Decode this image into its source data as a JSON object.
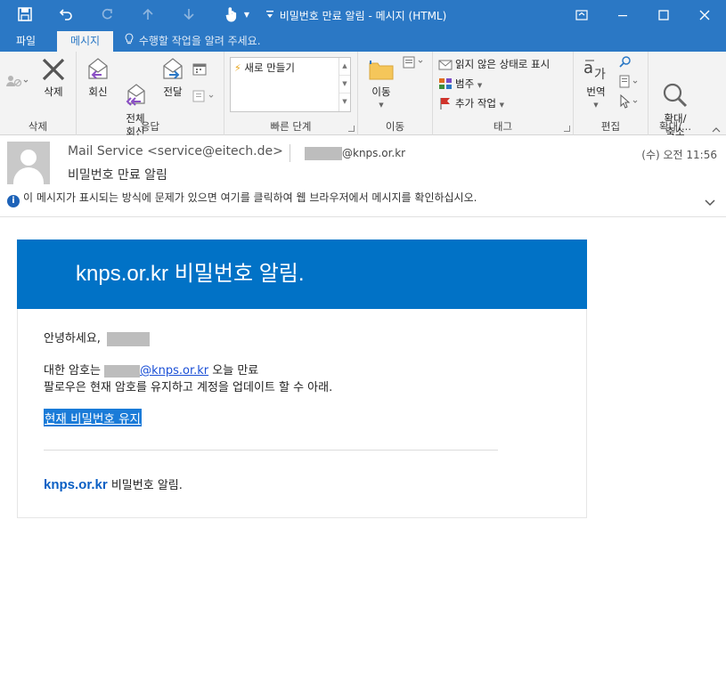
{
  "window": {
    "title": "비밀번호 만료 알림 - 메시지 (HTML)",
    "colors": {
      "titlebar": "#2b78c5",
      "banner": "#0172c6",
      "link": "#1a4fd6"
    }
  },
  "tabs": {
    "file": "파일",
    "message": "메시지",
    "tellme": "수행할 작업을 알려 주세요."
  },
  "ribbon": {
    "delete_group": {
      "label": "삭제",
      "delete": "삭제"
    },
    "respond_group": {
      "label": "응답",
      "reply": "회신",
      "reply_all": "전체\n회신",
      "forward": "전달"
    },
    "quicksteps_group": {
      "label": "빠른 단계",
      "new_item": "새로 만들기"
    },
    "move_group": {
      "label": "이동",
      "move": "이동"
    },
    "tags_group": {
      "label": "태그",
      "unread": "읽지 않은 상태로 표시",
      "categorize": "범주",
      "followup": "추가 작업"
    },
    "edit_group": {
      "label": "편집",
      "translate": "번역"
    },
    "zoom_group": {
      "label": "확대/...",
      "zoom": "확대/\n축소"
    }
  },
  "header": {
    "from": "Mail Service <service@eitech.de>",
    "to_domain": "@knps.or.kr",
    "date": "(수) 오전 11:56",
    "subject": "비밀번호 만료 알림",
    "infobar": "이 메시지가 표시되는 방식에 문제가 있으면 여기를 클릭하여 웹 브라우저에서 메시지를 확인하십시오."
  },
  "body": {
    "banner": "knps.or.kr 비밀번호 알림.",
    "greeting": "안녕하세요,",
    "line1_prefix": "대한 암호는",
    "line1_email": "@knps.or.kr",
    "line1_suffix": "오늘 만료",
    "line2": "팔로우은 현재 암호를 유지하고 계정을 업데이트 할 수 아래.",
    "cta": "현재 비밀번호 유지",
    "footer_brand": "knps.or.kr",
    "footer_text": "비밀번호 알림."
  }
}
